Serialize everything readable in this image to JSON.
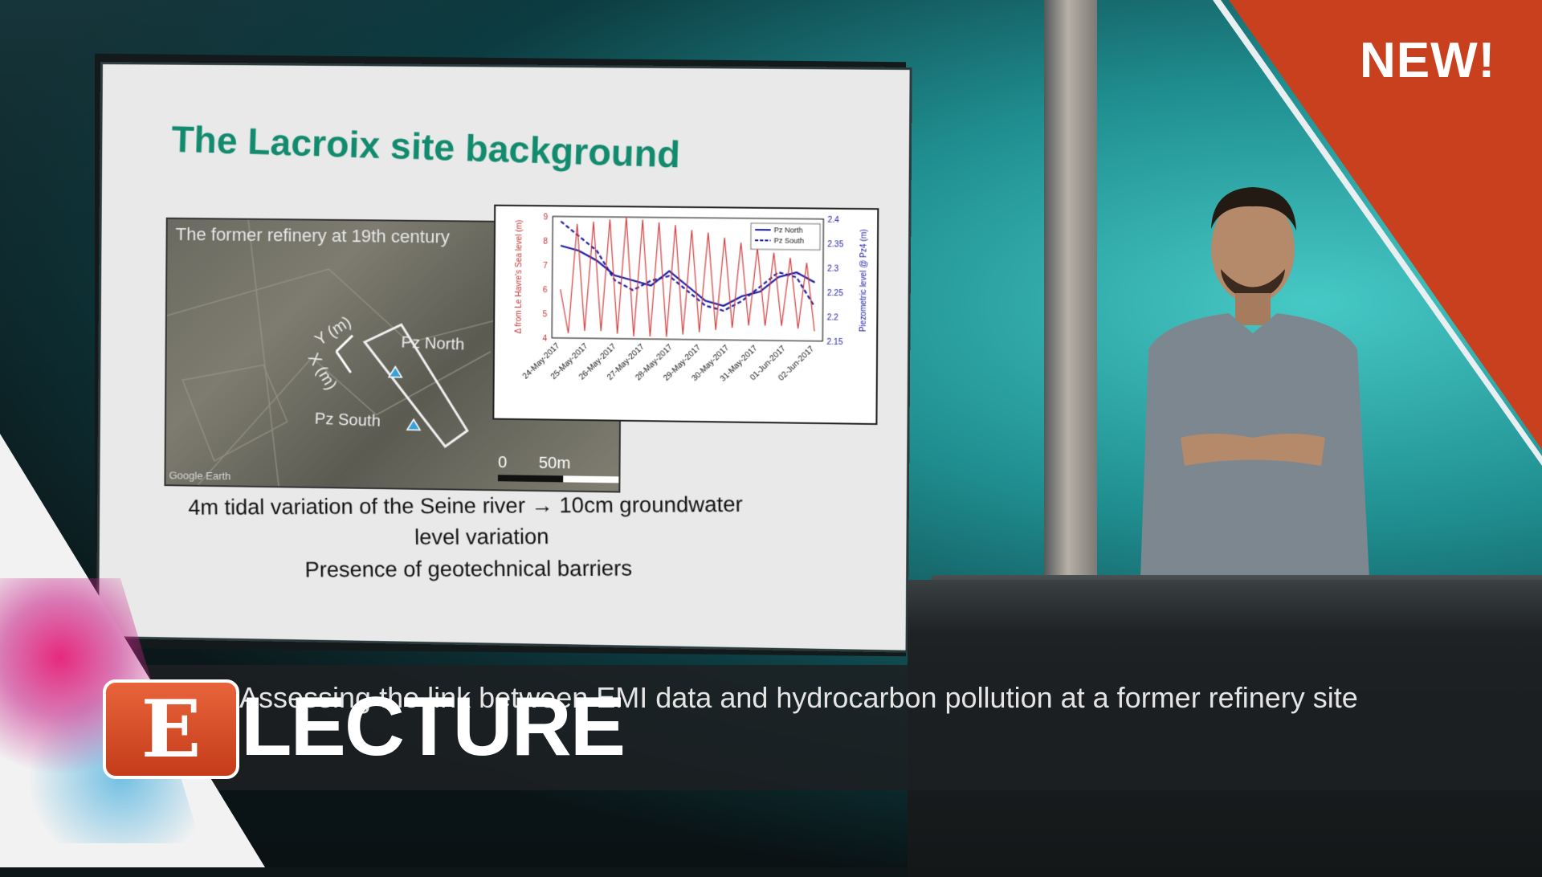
{
  "badge": {
    "new_label": "NEW!"
  },
  "slide": {
    "title": "The Lacroix site background",
    "map": {
      "caption": "The former refinery at 19th century",
      "label_north": "Pz North",
      "label_south": "Pz South",
      "axis_y": "Y (m)",
      "axis_x": "X (m)",
      "scale_zero": "0",
      "scale_max": "50m",
      "credit": "Google Earth"
    },
    "body_line_1": "4m tidal variation of the Seine river → 10cm groundwater",
    "body_line_2": "level variation",
    "body_line_3": "Presence of geotechnical barriers"
  },
  "lower_third": {
    "caption": "Assessing the link between EMI data and hydrocarbon pollution at a former refinery site",
    "brand_letter": "E",
    "brand_word": "LECTURE"
  },
  "chart_data": {
    "type": "line",
    "x": [
      "24-May-2017",
      "25-May-2017",
      "26-May-2017",
      "27-May-2017",
      "28-May-2017",
      "29-May-2017",
      "30-May-2017",
      "31-May-2017",
      "01-Jun-2017",
      "02-Jun-2017"
    ],
    "ylabel": "Δ from Le Havre's Sea level (m)",
    "ylabel_right": "Piezometric level @ Pz4 (m)",
    "ylim": [
      4,
      9
    ],
    "ylim_right": [
      2.15,
      2.4
    ],
    "yticks": [
      "4",
      "5",
      "6",
      "7",
      "8",
      "9"
    ],
    "yticks_right": [
      "2.15",
      "2.2",
      "2.25",
      "2.3",
      "2.35",
      "2.4"
    ],
    "legend": [
      "Pz North",
      "Pz South"
    ],
    "legend_position": "top-right",
    "series": [
      {
        "name": "Pz North",
        "axis": "right",
        "color": "#1a1aa0",
        "style": "solid",
        "values": [
          2.34,
          2.33,
          2.31,
          2.28,
          2.27,
          2.26,
          2.29,
          2.26,
          2.23,
          2.22,
          2.24,
          2.25,
          2.28,
          2.29,
          2.27
        ]
      },
      {
        "name": "Pz South",
        "axis": "right",
        "color": "#1a1aa0",
        "style": "dashed",
        "values": [
          2.39,
          2.36,
          2.33,
          2.27,
          2.25,
          2.27,
          2.28,
          2.25,
          2.22,
          2.21,
          2.23,
          2.26,
          2.29,
          2.28,
          2.22
        ]
      },
      {
        "axis": "left",
        "color": "#d03c3c",
        "style": "solid",
        "values": [
          6,
          4.2,
          8.7,
          4.3,
          8.8,
          4.3,
          8.9,
          4.2,
          9,
          4.1,
          8.9,
          4.1,
          8.8,
          4.1,
          8.7,
          4.2,
          8.5,
          4.3,
          8.4,
          4.4,
          8.2,
          4.5,
          8,
          4.6,
          7.8,
          4.6,
          7.6,
          4.6,
          7.4,
          4.5,
          7.2,
          4.4
        ]
      }
    ]
  }
}
